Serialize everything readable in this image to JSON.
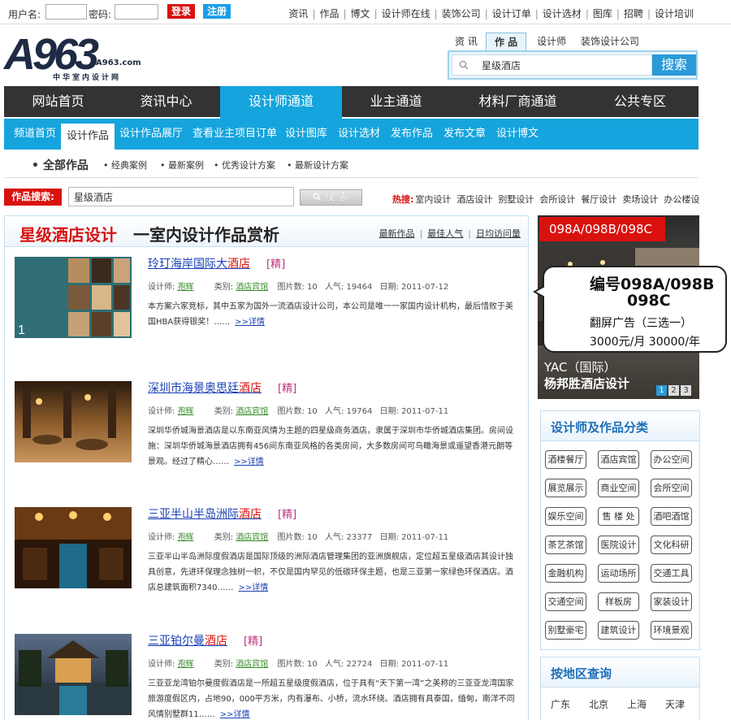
{
  "topbar": {
    "username_label": "用户名:",
    "password_label": "密码:",
    "login": "登录",
    "register": "注册",
    "links": [
      "资讯",
      "作品",
      "博文",
      "设计师在线",
      "装饰公司",
      "设计订单",
      "设计选材",
      "图库",
      "招聘",
      "设计培训"
    ]
  },
  "logo": {
    "mark": "A963",
    "domain": "A963.com",
    "tagline": "中华室内设计网"
  },
  "search": {
    "tabs": [
      "资 讯",
      "作 品",
      "设计师",
      "装饰设计公司"
    ],
    "active_tab": "作 品",
    "value": "星级酒店",
    "button": "搜索"
  },
  "mainnav": [
    "网站首页",
    "资讯中心",
    "设计师通道",
    "业主通道",
    "材料厂商通道",
    "公共专区"
  ],
  "subnav": [
    "频道首页",
    "设计作品",
    "设计作品展厅",
    "查看业主项目订单",
    "设计图库",
    "设计选材",
    "发布作品",
    "发布文章",
    "设计博文"
  ],
  "filters": {
    "all": "全部作品",
    "items": [
      "经典案例",
      "最新案例",
      "优秀设计方案",
      "最新设计方案"
    ]
  },
  "work_search": {
    "label": "作品搜索:",
    "value": "星级酒店",
    "button": "搜 索",
    "hot_label": "热搜:",
    "hot": [
      "室内设计",
      "酒店设计",
      "别墅设计",
      "会所设计",
      "餐厅设计",
      "卖场设计",
      "办公楼设"
    ]
  },
  "content": {
    "title_red": "星级酒店设计",
    "title_black": "一室内设计作品赏析",
    "sort": [
      "最新作品",
      "最佳人气",
      "日均访问量"
    ],
    "entries": [
      {
        "title_pre": "玲玎海岸国际大",
        "title_kw": "酒店",
        "tag": "[精]",
        "designer_label": "设计师:",
        "designer": "孢辉",
        "cat_label": "类别:",
        "category": "酒店宾馆",
        "pics": "图片数: 10",
        "pop": "人气: 19464",
        "date": "日期: 2011-07-12",
        "desc": "本方案六家竞标，其中五家为国外一流酒店设计公司，本公司是唯一一家国内设计机构，最后惜败于美国HBA获得银奖！……",
        "more": ">>详情"
      },
      {
        "title_pre": "深圳市海景奥思廷",
        "title_kw": "酒店",
        "tag": "[精]",
        "designer_label": "设计师:",
        "designer": "孢辉",
        "cat_label": "类别:",
        "category": "酒店宾馆",
        "pics": "图片数: 10",
        "pop": "人气: 19764",
        "date": "日期: 2011-07-11",
        "desc": "深圳华侨城海景酒店是以东南亚风情为主题的四星级商务酒店，隶属于深圳市华侨城酒店集团。房间设施：深圳华侨城海景酒店拥有456间东南亚风格的各类房间，大多数房间可鸟瞰海景或遥望香港元朗等景观。经过了精心……",
        "more": ">>详情"
      },
      {
        "title_pre": "三亚半山半岛洲际",
        "title_kw": "酒店",
        "tag": "[精]",
        "designer_label": "设计师:",
        "designer": "孢辉",
        "cat_label": "类别:",
        "category": "酒店宾馆",
        "pics": "图片数: 10",
        "pop": "人气: 23377",
        "date": "日期: 2011-07-11",
        "desc": "三亚半山半岛洲际度假酒店是国际顶级的洲际酒店管理集团的亚洲旗舰店，定位超五星级酒店其设计独具创意，先进环保理念独树一帜，不仅是国内罕见的低碳环保主题，也是三亚第一家绿色环保酒店。酒店总建筑面积7340……",
        "more": ">>详情"
      },
      {
        "title_pre": "三亚铂尔曼",
        "title_kw": "酒店",
        "tag": "[精]",
        "designer_label": "设计师:",
        "designer": "孢辉",
        "cat_label": "类别:",
        "category": "酒店宾馆",
        "pics": "图片数: 10",
        "pop": "人气: 22724",
        "date": "日期: 2011-07-11",
        "desc": "三亚亚龙湾铂尔曼度假酒店是一所超五星级度假酒店，位于具有“天下第一湾”之美称的三亚亚龙湾国家旅游度假区内，占地90，000平方米，内有瀑布、小桥，流水环绕。酒店拥有具泰国，缅甸，南洋不同风情别墅群11……",
        "more": ">>详情"
      }
    ]
  },
  "ad": {
    "header": "098A/098B/098C",
    "callout_l1": "编号098A/098B",
    "callout_l2": "098C",
    "callout_l3": "翻屏广告（三选一）",
    "callout_l4": "3000元/月   30000/年",
    "caption1": "YAC（国际）",
    "caption2": "杨邦胜酒店设计",
    "pages": [
      "1",
      "2",
      "3"
    ]
  },
  "categories": {
    "title": "设计师及作品分类",
    "items": [
      "酒楼餐厅",
      "酒店宾馆",
      "办公空间",
      "展览展示",
      "商业空间",
      "会所空间",
      "娱乐空间",
      "售 楼 处",
      "酒吧酒馆",
      "茶艺茶馆",
      "医院设计",
      "文化科研",
      "金融机构",
      "运动场所",
      "交通工具",
      "交通空间",
      "样板房",
      "家装设计",
      "别墅豪宅",
      "建筑设计",
      "环境景观"
    ]
  },
  "regions": {
    "title": "按地区查询",
    "items": [
      "广东",
      "北京",
      "上海",
      "天津"
    ]
  },
  "colors": {
    "accent_blue": "#15a4dd",
    "dark_nav": "#333333",
    "brand_red": "#d9120f"
  }
}
